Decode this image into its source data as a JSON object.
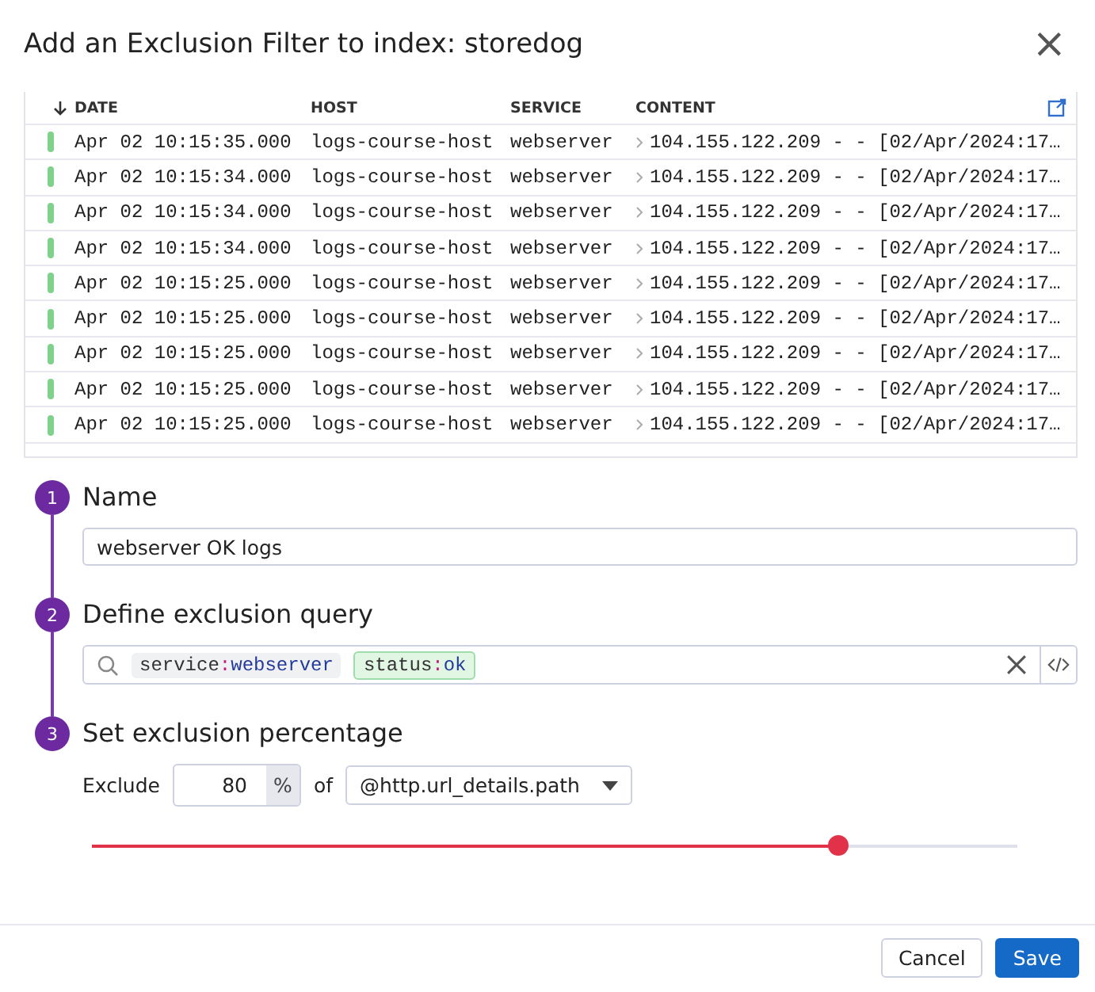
{
  "dialog": {
    "title": "Add an Exclusion Filter to index: storedog",
    "close": "×"
  },
  "table": {
    "columns": [
      {
        "label": "DATE",
        "sorted": true
      },
      {
        "label": "HOST",
        "sorted": false
      },
      {
        "label": "SERVICE",
        "sorted": false
      },
      {
        "label": "CONTENT",
        "sorted": false
      }
    ],
    "rows": [
      {
        "date": "Apr 02 10:15:35.000",
        "host": "logs-course-host",
        "service": "webserver",
        "content": "104.155.122.209 - - [02/Apr/2024:17…"
      },
      {
        "date": "Apr 02 10:15:34.000",
        "host": "logs-course-host",
        "service": "webserver",
        "content": "104.155.122.209 - - [02/Apr/2024:17…"
      },
      {
        "date": "Apr 02 10:15:34.000",
        "host": "logs-course-host",
        "service": "webserver",
        "content": "104.155.122.209 - - [02/Apr/2024:17…"
      },
      {
        "date": "Apr 02 10:15:34.000",
        "host": "logs-course-host",
        "service": "webserver",
        "content": "104.155.122.209 - - [02/Apr/2024:17…"
      },
      {
        "date": "Apr 02 10:15:25.000",
        "host": "logs-course-host",
        "service": "webserver",
        "content": "104.155.122.209 - - [02/Apr/2024:17…"
      },
      {
        "date": "Apr 02 10:15:25.000",
        "host": "logs-course-host",
        "service": "webserver",
        "content": "104.155.122.209 - - [02/Apr/2024:17…"
      },
      {
        "date": "Apr 02 10:15:25.000",
        "host": "logs-course-host",
        "service": "webserver",
        "content": "104.155.122.209 - - [02/Apr/2024:17…"
      },
      {
        "date": "Apr 02 10:15:25.000",
        "host": "logs-course-host",
        "service": "webserver",
        "content": "104.155.122.209 - - [02/Apr/2024:17…"
      },
      {
        "date": "Apr 02 10:15:25.000",
        "host": "logs-course-host",
        "service": "webserver",
        "content": "104.155.122.209 - - [02/Apr/2024:17…"
      }
    ]
  },
  "steps": [
    {
      "number": "1",
      "title": "Name"
    },
    {
      "number": "2",
      "title": "Define exclusion query"
    },
    {
      "number": "3",
      "title": "Set exclusion percentage"
    }
  ],
  "name_field": {
    "value": "webserver OK logs"
  },
  "query": {
    "terms": [
      {
        "key": "service",
        "separator": ":",
        "value": "webserver",
        "kind": "plain"
      },
      {
        "key": "status",
        "separator": ":",
        "value": "ok",
        "kind": "status"
      }
    ]
  },
  "exclusion": {
    "label": "Exclude",
    "percent": "80",
    "unit": "%",
    "of": "of",
    "attribute": "@http.url_details.path",
    "level": 0.8
  },
  "buttons": [
    {
      "label": "Cancel",
      "kind": "secondary"
    },
    {
      "label": "Save",
      "kind": "primary"
    }
  ]
}
